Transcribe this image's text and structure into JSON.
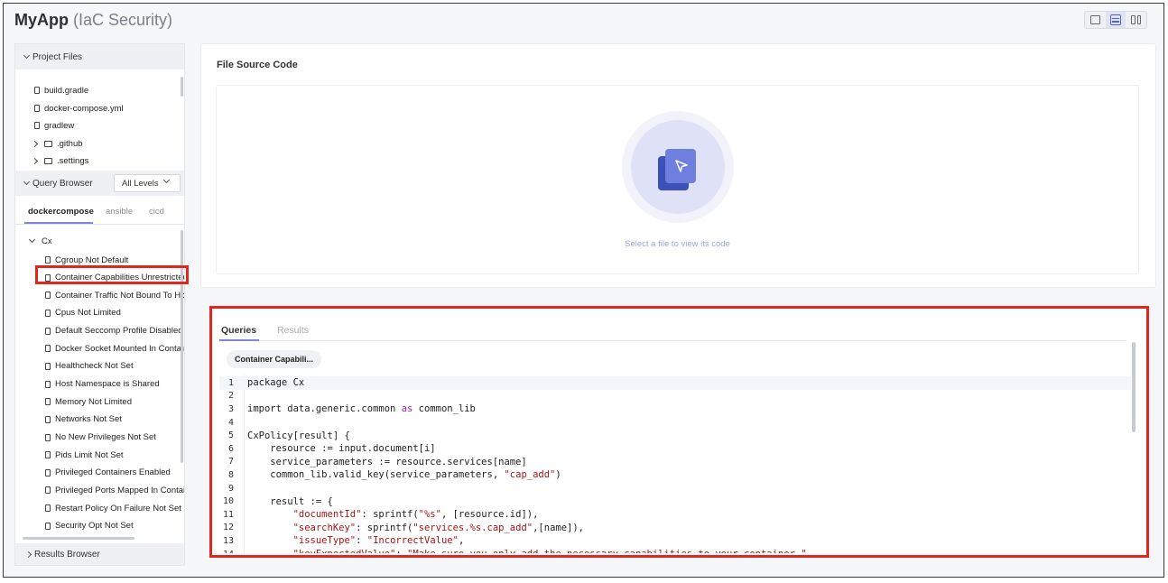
{
  "header": {
    "app_name": "MyApp",
    "app_subtitle": "(IaC Security)"
  },
  "sidebar": {
    "project_files": {
      "title": "Project Files",
      "items": [
        {
          "type": "file",
          "name": "build.gradle"
        },
        {
          "type": "file",
          "name": "docker-compose.yml"
        },
        {
          "type": "file",
          "name": "gradlew"
        },
        {
          "type": "folder",
          "name": ".github"
        },
        {
          "type": "folder",
          "name": ".settings"
        }
      ]
    },
    "query_browser": {
      "title": "Query Browser",
      "level_select": "All Levels",
      "tabs": [
        "dockercompose",
        "ansible",
        "cicd"
      ],
      "active_tab": "dockercompose",
      "group": "Cx",
      "queries": [
        "Cgroup Not Default",
        "Container Capabilities Unrestricted",
        "Container Traffic Not Bound To Host Interface",
        "Cpus Not Limited",
        "Default Seccomp Profile Disabled",
        "Docker Socket Mounted In Container",
        "Healthcheck Not Set",
        "Host Namespace is Shared",
        "Memory Not Limited",
        "Networks Not Set",
        "No New Privileges Not Set",
        "Pids Limit Not Set",
        "Privileged Containers Enabled",
        "Privileged Ports Mapped In Container",
        "Restart Policy On Failure Not Set",
        "Security Opt Not Set"
      ],
      "selected_query": "Container Capabilities Unrestricted"
    },
    "results_browser": {
      "title": "Results Browser"
    }
  },
  "source_panel": {
    "title": "File Source Code",
    "empty_message": "Select a file to view its code"
  },
  "queries_panel": {
    "tabs": [
      "Queries",
      "Results"
    ],
    "active_tab": "Queries",
    "open_query_pill": "Container Capabili...",
    "code_lines": [
      [
        {
          "t": "package Cx"
        }
      ],
      [],
      [
        {
          "t": "import data.generic.common "
        },
        {
          "t": "as",
          "c": "k"
        },
        {
          "t": " common_lib"
        }
      ],
      [],
      [
        {
          "t": "CxPolicy[result] {"
        }
      ],
      [
        {
          "t": "    resource := input.document[i]"
        }
      ],
      [
        {
          "t": "    service_parameters := resource.services[name]"
        }
      ],
      [
        {
          "t": "    common_lib.valid_key(service_parameters, "
        },
        {
          "t": "\"cap_add\"",
          "c": "s"
        },
        {
          "t": ")"
        }
      ],
      [],
      [
        {
          "t": "    result := {"
        }
      ],
      [
        {
          "t": "        "
        },
        {
          "t": "\"documentId\"",
          "c": "s"
        },
        {
          "t": ": sprintf("
        },
        {
          "t": "\"%s\"",
          "c": "s"
        },
        {
          "t": ", [resource.id]),"
        }
      ],
      [
        {
          "t": "        "
        },
        {
          "t": "\"searchKey\"",
          "c": "s"
        },
        {
          "t": ": sprintf("
        },
        {
          "t": "\"services.%s.cap_add\"",
          "c": "s"
        },
        {
          "t": ",[name]),"
        }
      ],
      [
        {
          "t": "        "
        },
        {
          "t": "\"issueType\"",
          "c": "s"
        },
        {
          "t": ": "
        },
        {
          "t": "\"IncorrectValue\"",
          "c": "s"
        },
        {
          "t": ","
        }
      ],
      [
        {
          "t": "        "
        },
        {
          "t": "\"keyExpectedValue\"",
          "c": "s"
        },
        {
          "t": ": "
        },
        {
          "t": "\"Make sure you only add the necessary capabilities to your container.\"",
          "c": "s"
        },
        {
          "t": ","
        }
      ]
    ]
  },
  "colors": {
    "accent": "#7c87d9",
    "highlight_border": "#e0271f",
    "keyword": "#8b2c9c",
    "string": "#a31515"
  }
}
